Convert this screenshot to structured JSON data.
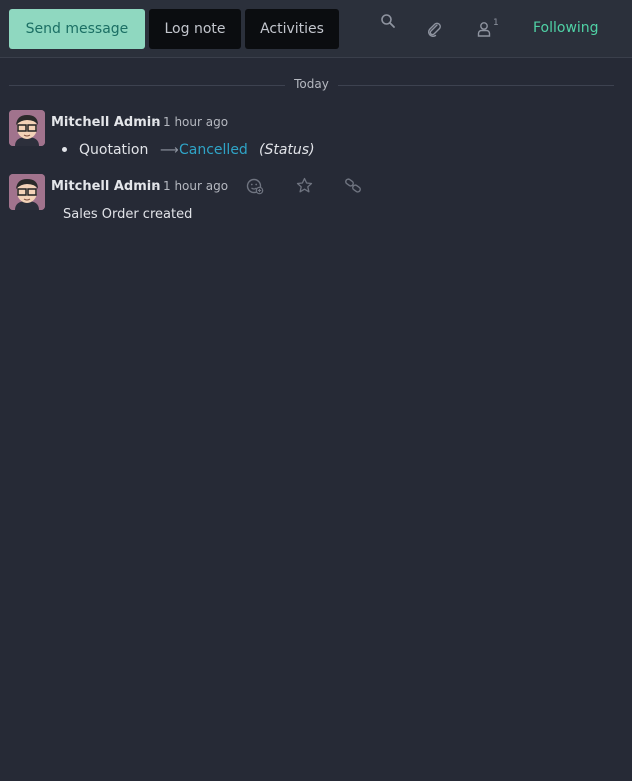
{
  "toolbar": {
    "send_message": "Send message",
    "log_note": "Log note",
    "activities": "Activities",
    "follower_count": "1",
    "following": "Following"
  },
  "thread": {
    "date_separator": "Today",
    "messages": [
      {
        "author": "Mitchell Admin",
        "separator": "-",
        "date": "1 hour ago",
        "tracking": {
          "old_value": "Quotation",
          "new_value": "Cancelled",
          "field": "(Status)"
        }
      },
      {
        "author": "Mitchell Admin",
        "separator": "-",
        "date": "1 hour ago",
        "body": "Sales Order created"
      }
    ]
  },
  "icons": {
    "search": "search-icon",
    "attachment": "paperclip-icon",
    "followers": "user-icon",
    "reaction": "add-reaction-icon",
    "star": "star-icon",
    "link": "link-icon"
  },
  "colors": {
    "background": "#262a36",
    "primary_button": "#8fd8c0",
    "following": "#4fd1a5",
    "tracking_new_value": "#2fa4c7"
  }
}
